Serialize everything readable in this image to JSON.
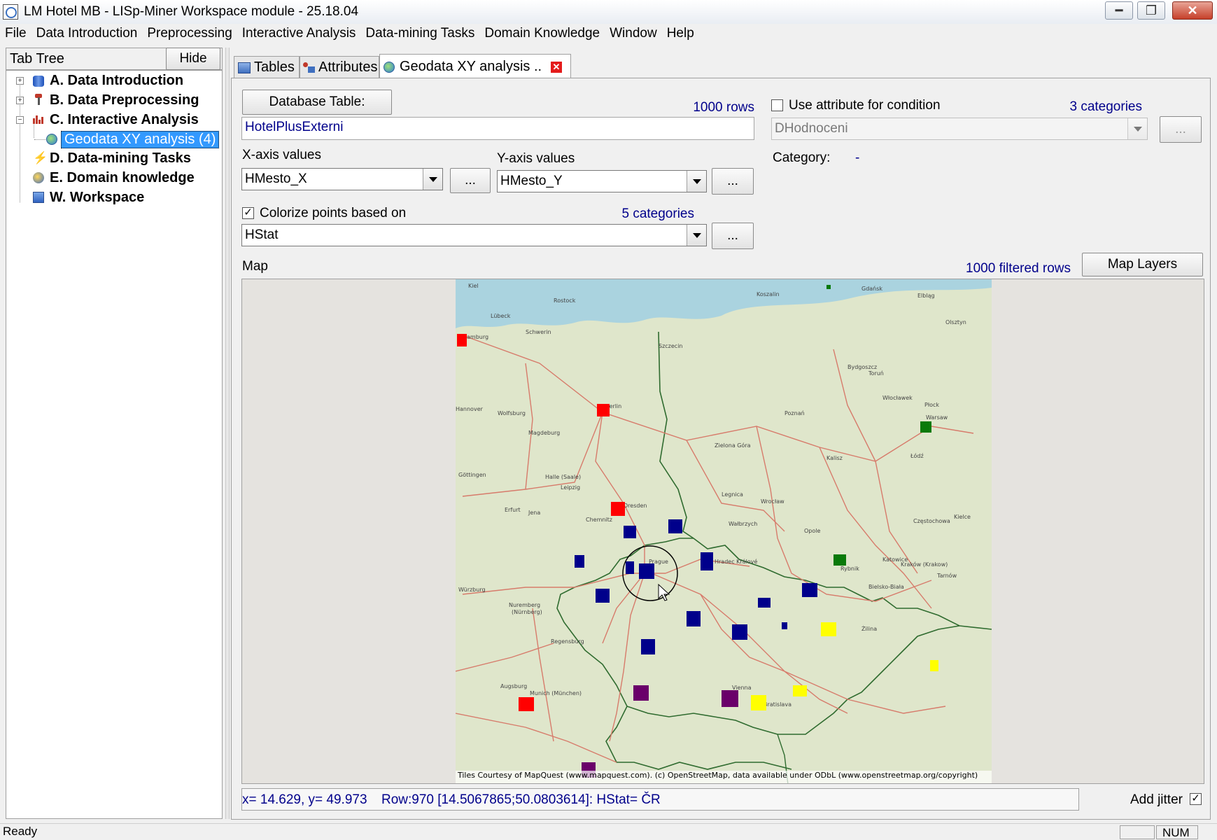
{
  "window": {
    "title": "LM Hotel MB - LISp-Miner Workspace module - 25.18.04"
  },
  "menu": [
    "File",
    "Data Introduction",
    "Preprocessing",
    "Interactive Analysis",
    "Data-mining Tasks",
    "Domain Knowledge",
    "Window",
    "Help"
  ],
  "tabtree": {
    "label": "Tab Tree",
    "hide_label": "Hide",
    "items": [
      {
        "label": "A. Data Introduction"
      },
      {
        "label": "B. Data Preprocessing"
      },
      {
        "label": "C. Interactive Analysis"
      },
      {
        "label": "Geodata XY analysis (4)"
      },
      {
        "label": "D. Data-mining Tasks"
      },
      {
        "label": "E. Domain knowledge"
      },
      {
        "label": "W. Workspace"
      }
    ]
  },
  "tabs": [
    {
      "label": "Tables"
    },
    {
      "label": "Attributes"
    },
    {
      "label": "Geodata XY analysis .."
    }
  ],
  "form": {
    "db_table_button": "Database Table:",
    "rows_count": "1000 rows",
    "table_name": "HotelPlusExterni",
    "x_axis_label": "X-axis values",
    "x_axis_value": "HMesto_X",
    "y_axis_label": "Y-axis values",
    "y_axis_value": "HMesto_Y",
    "ellipsis": "...",
    "colorize_label": "Colorize points based on",
    "colorize_checked": "✓",
    "colorize_categories": "5 categories",
    "colorize_value": "HStat",
    "use_attr_label": "Use attribute for condition",
    "use_attr_categories": "3 categories",
    "use_attr_value": "DHodnoceni",
    "category_label": "Category:",
    "category_value": "-",
    "map_label": "Map",
    "filtered_rows": "1000 filtered rows",
    "map_layers_button": "Map Layers"
  },
  "map": {
    "attribution": "Tiles Courtesy of MapQuest (www.mapquest.com). (c) OpenStreetMap, data available under ODbL (www.openstreetmap.org/copyright)",
    "colors": {
      "red": "#ff0000",
      "navy": "#00008b",
      "green": "#0a7a0a",
      "yellow": "#ffff00",
      "purple": "#6a006a",
      "water": "#aad3df",
      "land": "#dfe6cb",
      "border": "#2f6b2f",
      "road": "#d77b6b"
    },
    "cities": [
      {
        "name": "Kiel"
      },
      {
        "name": "Rostock"
      },
      {
        "name": "Lübeck"
      },
      {
        "name": "Hamburg"
      },
      {
        "name": "Schwerin"
      },
      {
        "name": "Szczecin"
      },
      {
        "name": "Koszalin"
      },
      {
        "name": "Elbląg"
      },
      {
        "name": "Olsztyn"
      },
      {
        "name": "Gdańsk"
      },
      {
        "name": "Bydgoszcz"
      },
      {
        "name": "Toruń"
      },
      {
        "name": "Włocławek"
      },
      {
        "name": "Płock"
      },
      {
        "name": "Poznań"
      },
      {
        "name": "Berlin"
      },
      {
        "name": "Hannover"
      },
      {
        "name": "Wolfsburg"
      },
      {
        "name": "Magdeburg"
      },
      {
        "name": "Göttingen"
      },
      {
        "name": "Halle (Saale)"
      },
      {
        "name": "Leipzig"
      },
      {
        "name": "Dresden"
      },
      {
        "name": "Chemnitz"
      },
      {
        "name": "Erfurt"
      },
      {
        "name": "Jena"
      },
      {
        "name": "Zielona Góra"
      },
      {
        "name": "Legnica"
      },
      {
        "name": "Wrocław"
      },
      {
        "name": "Wałbrzych"
      },
      {
        "name": "Opole"
      },
      {
        "name": "Łódź"
      },
      {
        "name": "Kalisz"
      },
      {
        "name": "Kielce"
      },
      {
        "name": "Częstochowa"
      },
      {
        "name": "Katowice"
      },
      {
        "name": "Kraków (Krakow)"
      },
      {
        "name": "Rybnik"
      },
      {
        "name": "Bielsko-Biała"
      },
      {
        "name": "Prague (Praha)"
      },
      {
        "name": "Hradec Králové"
      },
      {
        "name": "Würzburg"
      },
      {
        "name": "Nuremberg (Nürnberg)"
      },
      {
        "name": "Regensburg"
      },
      {
        "name": "Augsburg"
      },
      {
        "name": "Munich (München)"
      },
      {
        "name": "Vienna"
      },
      {
        "name": "Bratislava"
      },
      {
        "name": "Warsaw"
      },
      {
        "name": "Tarnów"
      },
      {
        "name": "Żilina"
      }
    ]
  },
  "status": {
    "coords": "x= 14.629, y= 49.973",
    "row_info": "Row:970 [14.5067865;50.0803614]: HStat= ČR",
    "add_jitter_label": "Add jitter",
    "add_jitter_checked": "✓",
    "ready": "Ready",
    "num": "NUM"
  }
}
